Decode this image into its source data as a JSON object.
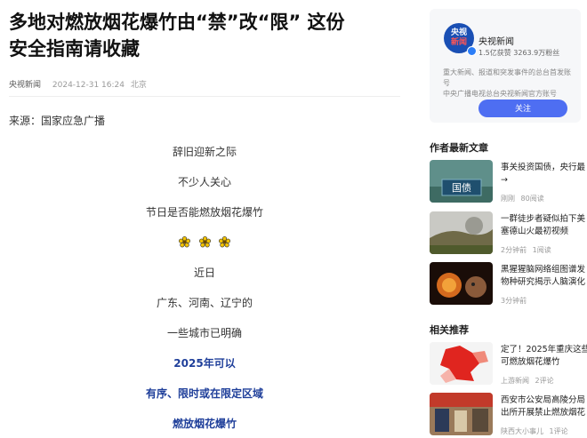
{
  "article": {
    "title_line1": "多地对燃放烟花爆竹由“禁”改“限” 这份",
    "title_line2": "安全指南请收藏",
    "author": "央视新闻",
    "date": "2024-12-31 16:24",
    "location": "北京",
    "source": "来源：国家应急广播",
    "lines": {
      "l1": "辞旧迎新之际",
      "l2": "不少人关心",
      "l3": "节日是否能燃放烟花爆竹",
      "l4": "近日",
      "l5": "广东、河南、辽宁的",
      "l6": "一些城市已明确",
      "l7": "2025年可以",
      "l8": "有序、限时或在限定区域",
      "l9": "燃放烟花爆竹"
    },
    "colors": {
      "highlight": "#1f3f9a"
    }
  },
  "sidebar": {
    "account": {
      "avatar_line1": "央视",
      "avatar_line2": "新闻",
      "name": "央视新闻",
      "stats": "1.5亿获赞 3263.9万粉丝",
      "desc_line1": "重大新闻、报道和突发事件的总台首发账号",
      "desc_line2": "中央广播电视总台央视新闻官方账号",
      "follow_label": "关注",
      "accent": "#4e6ef2"
    },
    "author_latest": {
      "heading": "作者最新文章",
      "items": [
        {
          "title1": "事关投资国债，央行最",
          "title2": "→",
          "meta_a": "刚刚",
          "meta_b": "80阅读"
        },
        {
          "title1": "一群徒步者疑似拍下美",
          "title2": "塞德山火最初视频",
          "meta_a": "2分钟前",
          "meta_b": "1阅读"
        },
        {
          "title1": "黑猩猩脑网络组图谱发",
          "title2": "物种研究揭示人脑演化",
          "meta_a": "3分钟前",
          "meta_b": ""
        }
      ]
    },
    "related": {
      "heading": "相关推荐",
      "items": [
        {
          "title1": "定了！2025年重庆这些",
          "title2": "可燃放烟花爆竹",
          "meta_a": "上游新闻",
          "meta_b": "2评论"
        },
        {
          "title1": "西安市公安局高陵分局",
          "title2": "出所开展禁止燃放烟花",
          "meta_a": "陕西大小事儿",
          "meta_b": "1评论"
        }
      ]
    }
  }
}
